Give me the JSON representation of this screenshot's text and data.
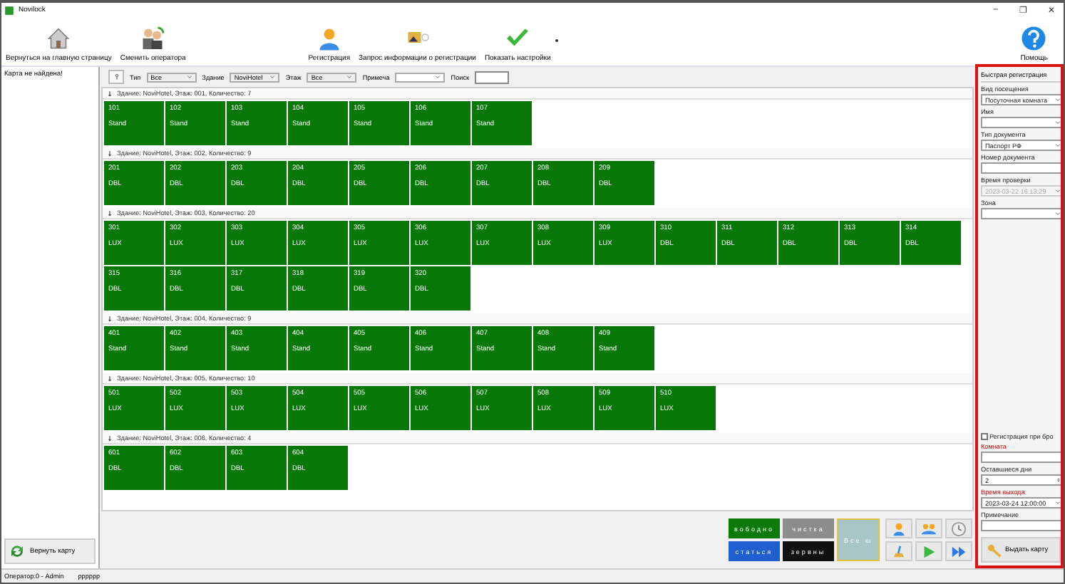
{
  "window": {
    "title": "Novilock",
    "controls": [
      "–",
      "❐",
      "✕"
    ]
  },
  "toolbar": {
    "buttons": [
      {
        "label": "Вернуться на главную страницу"
      },
      {
        "label": "Сменить оператора"
      },
      {
        "label": "Регистрация"
      },
      {
        "label": "Запрос информации о регистрации"
      },
      {
        "label": "Показать настройки"
      }
    ],
    "help": {
      "label": "Помощь"
    }
  },
  "left_panel": {
    "message": "Карта не найдена!",
    "return_button": "Вернуть карту"
  },
  "filter": {
    "fields": [
      {
        "label": "Тип",
        "value": "Все"
      },
      {
        "label": "Здание",
        "value": "NoviHotel"
      },
      {
        "label": "Этаж",
        "value": "Все"
      },
      {
        "label": "Примеча"
      }
    ],
    "search_label": "Поиск"
  },
  "floors": [
    {
      "header": "Здание: NoviHotel, Этаж: 001, Количество: 7",
      "rooms": [
        {
          "number": "101",
          "type": "Stand"
        },
        {
          "number": "102",
          "type": "Stand"
        },
        {
          "number": "103",
          "type": "Stand"
        },
        {
          "number": "104",
          "type": "Stand"
        },
        {
          "number": "105",
          "type": "Stand"
        },
        {
          "number": "106",
          "type": "Stand"
        },
        {
          "number": "107",
          "type": "Stand"
        }
      ]
    },
    {
      "header": "Здание: NoviHotel, Этаж: 002, Количество: 9",
      "rooms": [
        {
          "number": "201",
          "type": "DBL"
        },
        {
          "number": "202",
          "type": "DBL"
        },
        {
          "number": "203",
          "type": "DBL"
        },
        {
          "number": "204",
          "type": "DBL"
        },
        {
          "number": "205",
          "type": "DBL"
        },
        {
          "number": "206",
          "type": "DBL"
        },
        {
          "number": "207",
          "type": "DBL"
        },
        {
          "number": "208",
          "type": "DBL"
        },
        {
          "number": "209",
          "type": "DBL"
        }
      ]
    },
    {
      "header": "Здание: NoviHotel, Этаж: 003, Количество: 20",
      "rooms": [
        {
          "number": "301",
          "type": "LUX"
        },
        {
          "number": "302",
          "type": "LUX"
        },
        {
          "number": "303",
          "type": "LUX"
        },
        {
          "number": "304",
          "type": "LUX"
        },
        {
          "number": "305",
          "type": "LUX"
        },
        {
          "number": "306",
          "type": "LUX"
        },
        {
          "number": "307",
          "type": "LUX"
        },
        {
          "number": "308",
          "type": "LUX"
        },
        {
          "number": "309",
          "type": "LUX"
        },
        {
          "number": "310",
          "type": "DBL"
        },
        {
          "number": "311",
          "type": "DBL"
        },
        {
          "number": "312",
          "type": "DBL"
        },
        {
          "number": "313",
          "type": "DBL"
        },
        {
          "number": "314",
          "type": "DBL"
        },
        {
          "number": "315",
          "type": "DBL"
        },
        {
          "number": "316",
          "type": "DBL"
        },
        {
          "number": "317",
          "type": "DBL"
        },
        {
          "number": "318",
          "type": "DBL"
        },
        {
          "number": "319",
          "type": "DBL"
        },
        {
          "number": "320",
          "type": "DBL"
        }
      ]
    },
    {
      "header": "Здание: NoviHotel, Этаж: 004, Количество: 9",
      "rooms": [
        {
          "number": "401",
          "type": "Stand"
        },
        {
          "number": "402",
          "type": "Stand"
        },
        {
          "number": "403",
          "type": "Stand"
        },
        {
          "number": "404",
          "type": "Stand"
        },
        {
          "number": "405",
          "type": "Stand"
        },
        {
          "number": "406",
          "type": "Stand"
        },
        {
          "number": "407",
          "type": "Stand"
        },
        {
          "number": "408",
          "type": "Stand"
        },
        {
          "number": "409",
          "type": "Stand"
        }
      ]
    },
    {
      "header": "Здание: NoviHotel, Этаж: 005, Количество: 10",
      "rooms": [
        {
          "number": "501",
          "type": "LUX"
        },
        {
          "number": "502",
          "type": "LUX"
        },
        {
          "number": "503",
          "type": "LUX"
        },
        {
          "number": "504",
          "type": "LUX"
        },
        {
          "number": "505",
          "type": "LUX"
        },
        {
          "number": "506",
          "type": "LUX"
        },
        {
          "number": "507",
          "type": "LUX"
        },
        {
          "number": "508",
          "type": "LUX"
        },
        {
          "number": "509",
          "type": "LUX"
        },
        {
          "number": "510",
          "type": "LUX"
        }
      ]
    },
    {
      "header": "Здание: NoviHotel, Этаж: 006, Количество: 4",
      "rooms": [
        {
          "number": "601",
          "type": "DBL"
        },
        {
          "number": "602",
          "type": "DBL"
        },
        {
          "number": "603",
          "type": "DBL"
        },
        {
          "number": "604",
          "type": "DBL"
        }
      ]
    }
  ],
  "legend": [
    {
      "label": "вободно",
      "color": "#0b7a0b",
      "selected": false
    },
    {
      "label": "чистка",
      "color": "#8c8c8c",
      "selected": false
    },
    {
      "label": "статься",
      "color": "#1f5fcf",
      "selected": false
    },
    {
      "label": "зервны",
      "color": "#111111",
      "selected": false
    },
    {
      "label": "Все ш",
      "color": "#a9c6c6",
      "selected": true
    }
  ],
  "registration": {
    "title": "Быстрая регистрация",
    "fields": [
      {
        "kind": "select",
        "label": "Вид посещения",
        "value": "Посуточная комната",
        "required": false,
        "disabled": false
      },
      {
        "kind": "select",
        "label": "Имя",
        "required": false,
        "disabled": false
      },
      {
        "kind": "select",
        "label": "Тип документа",
        "value": "Паспорт РФ",
        "required": false,
        "disabled": false
      },
      {
        "kind": "input",
        "label": "Номер документа",
        "required": false,
        "disabled": false
      },
      {
        "kind": "select",
        "label": "Время проверки",
        "value": "2023-03-22 16:13:29",
        "required": false,
        "disabled": true
      },
      {
        "kind": "select",
        "label": "Зона",
        "required": false,
        "disabled": false
      },
      {
        "kind": "checkbox",
        "label": "Регистрация при бро",
        "checked": false
      },
      {
        "kind": "input",
        "label": "Комната",
        "required": true,
        "disabled": false
      },
      {
        "kind": "spin",
        "label": "Оставшиеся дни",
        "value": "2",
        "required": false,
        "disabled": false
      },
      {
        "kind": "select",
        "label": "Время выхода",
        "value": "2023-03-24 12:00:00",
        "required": true,
        "disabled": false
      },
      {
        "kind": "input",
        "label": "Примечание",
        "required": false,
        "disabled": false
      }
    ],
    "issue_button": "Выдать карту"
  },
  "status_bar": {
    "operator": "Оператор:0 - Admin",
    "text": "pppppp"
  }
}
